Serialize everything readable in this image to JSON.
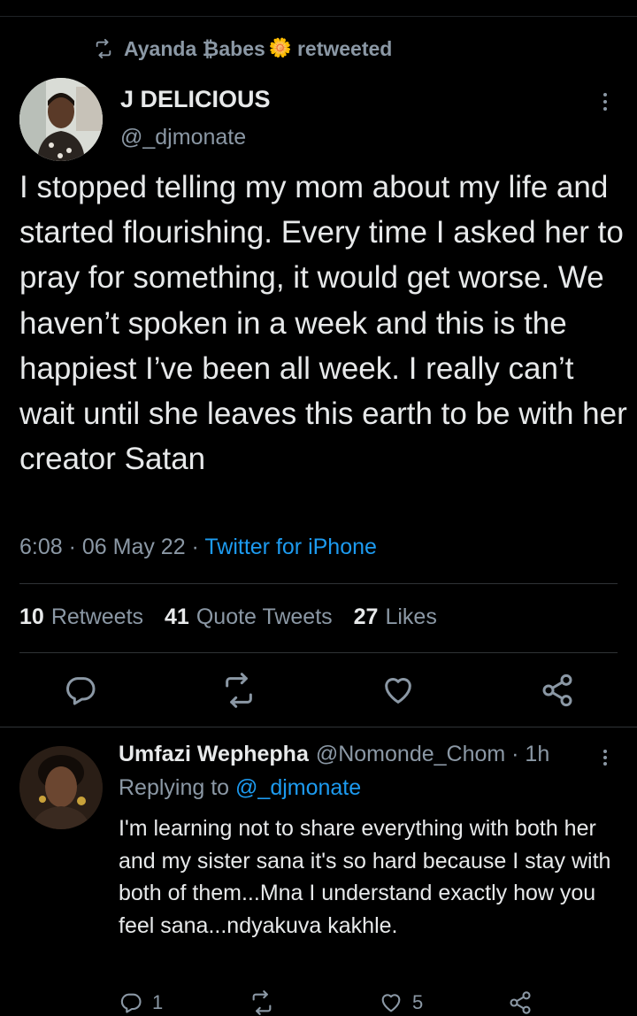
{
  "retweet_banner": {
    "user": "Ayanda ₿abes",
    "emoji": "🌼",
    "suffix": "retweeted"
  },
  "tweet": {
    "display_name": "J DELICIOUS",
    "handle": "@_djmonate",
    "text": "I stopped telling my mom about my life and started flourishing. Every time I asked her to pray for something, it would get worse. We haven’t spoken in a week and this is the happiest I’ve been all week. I really can’t wait until she leaves this earth to be with her creator Satan",
    "time": "6:08 · 06 May 22 ·",
    "source": "Twitter for iPhone",
    "stats": {
      "retweets_count": "10",
      "retweets_label": "Retweets",
      "quotes_count": "41",
      "quotes_label": "Quote Tweets",
      "likes_count": "27",
      "likes_label": "Likes"
    }
  },
  "reply": {
    "display_name": "Umfazi Wephepha",
    "handle_time": "@Nomonde_Chom · 1h",
    "replying_prefix": "Replying to",
    "replying_to": "@_djmonate",
    "text": "I'm learning not to share everything with both her and my sister sana it's so hard because I stay with both of them...Mna I understand exactly how you feel sana...ndyakuva kakhle.",
    "reply_count": "1",
    "like_count": "5"
  },
  "icons": [
    "retweet-icon",
    "more-icon",
    "reply-icon",
    "like-icon",
    "share-icon"
  ],
  "colors": {
    "background": "#000000",
    "text": "#e7e9ea",
    "secondary": "#8b98a5",
    "link": "#1d9bf0",
    "divider": "#2f3336"
  }
}
